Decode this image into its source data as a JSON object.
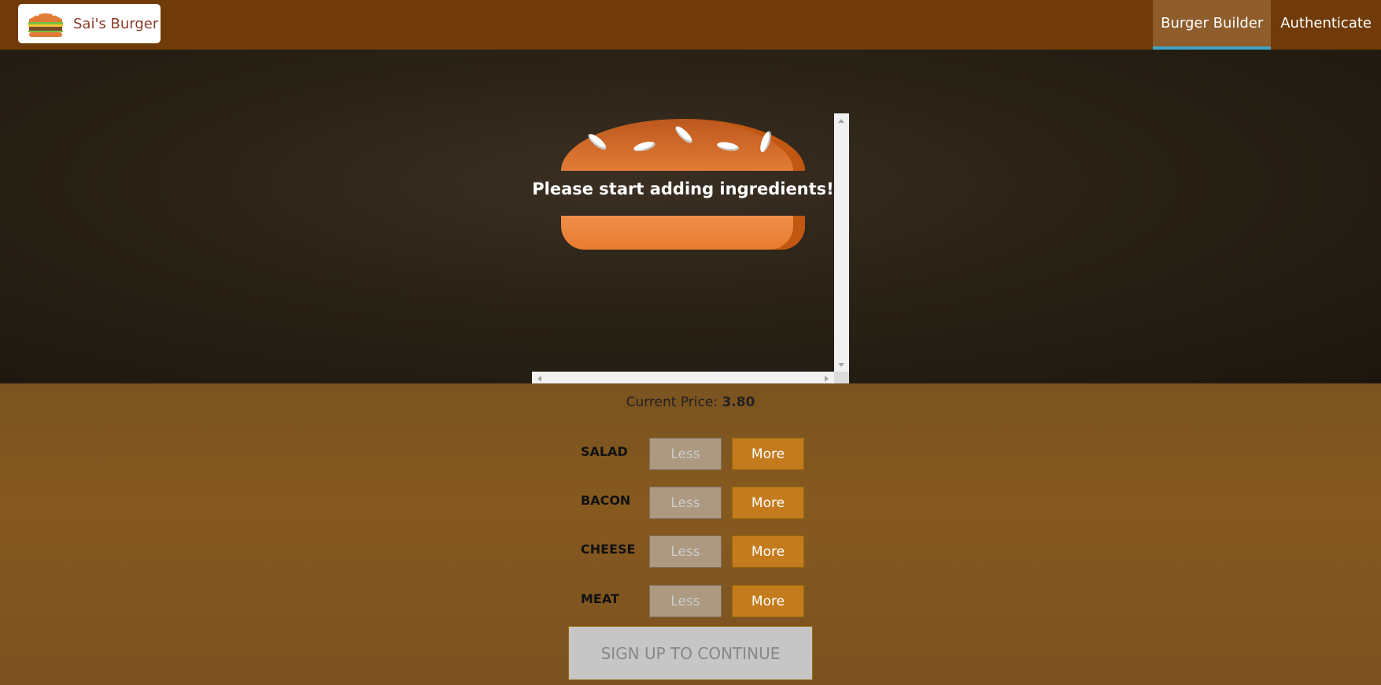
{
  "brand": {
    "name": "Sai's Burger"
  },
  "nav": {
    "items": [
      {
        "label": "Burger Builder",
        "active": true
      },
      {
        "label": "Authenticate",
        "active": false
      }
    ]
  },
  "burger": {
    "message": "Please start adding ingredients!"
  },
  "price": {
    "label": "Current Price:",
    "value": "3.80"
  },
  "controls": [
    {
      "label": "SALAD",
      "less": "Less",
      "more": "More"
    },
    {
      "label": "BACON",
      "less": "Less",
      "more": "More"
    },
    {
      "label": "CHEESE",
      "less": "Less",
      "more": "More"
    },
    {
      "label": "MEAT",
      "less": "Less",
      "more": "More"
    }
  ],
  "order_button": "SIGN UP TO CONTINUE",
  "colors": {
    "toolbar": "#703b09",
    "accent": "#40a4c8",
    "more_button": "#c47b1d"
  }
}
